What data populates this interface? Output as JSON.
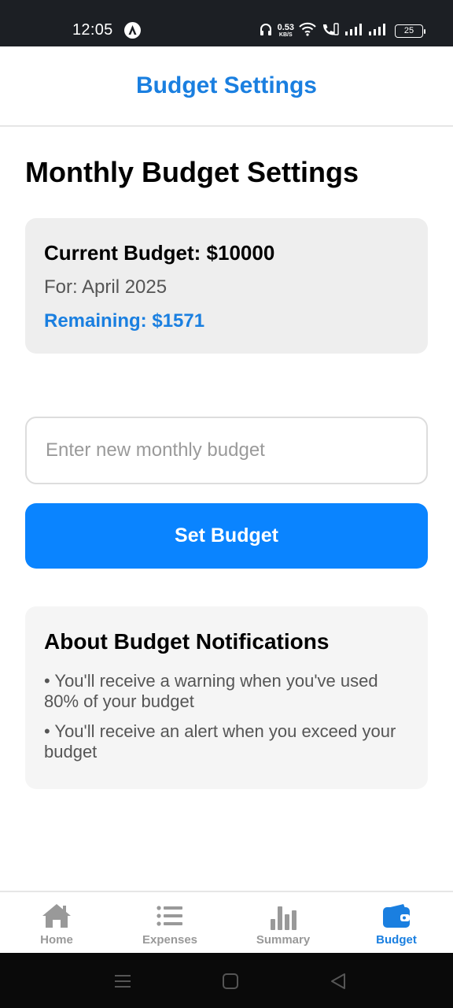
{
  "status_bar": {
    "time": "12:05",
    "net_speed_value": "0.53",
    "net_speed_unit": "KB/S",
    "battery": "25"
  },
  "header": {
    "title": "Budget Settings"
  },
  "page": {
    "heading": "Monthly Budget Settings"
  },
  "budget_card": {
    "current_budget": "Current Budget: $10000",
    "period": "For: April 2025",
    "remaining": "Remaining: $1571"
  },
  "budget_input": {
    "placeholder": "Enter new monthly budget",
    "value": ""
  },
  "set_budget_button": {
    "label": "Set Budget"
  },
  "info_card": {
    "title": "About Budget Notifications",
    "items": [
      "• You'll receive a warning when you've used 80% of your budget",
      "• You'll receive an alert when you exceed your budget"
    ]
  },
  "tabs": [
    {
      "label": "Home",
      "icon": "home-icon",
      "active": false
    },
    {
      "label": "Expenses",
      "icon": "list-icon",
      "active": false
    },
    {
      "label": "Summary",
      "icon": "bar-chart-icon",
      "active": false
    },
    {
      "label": "Budget",
      "icon": "wallet-icon",
      "active": true
    }
  ],
  "colors": {
    "accent": "#1a7fe0",
    "button": "#0a84ff",
    "inactive_tab": "#999999",
    "status_bar": "#1c1f24"
  }
}
